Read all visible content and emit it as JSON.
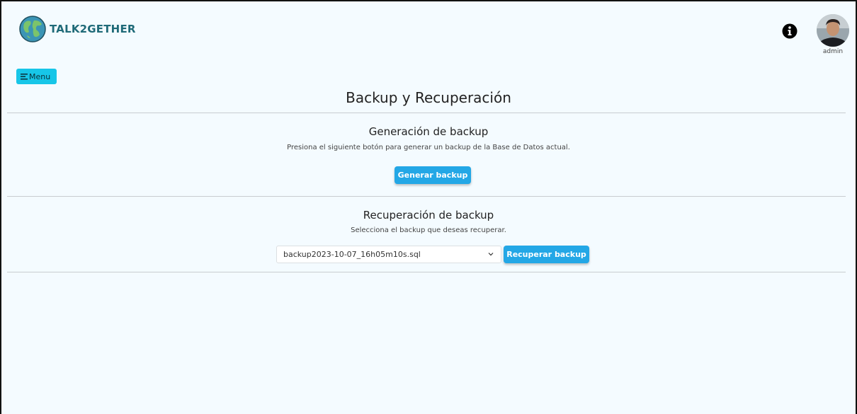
{
  "header": {
    "brand": "TALK2GETHER",
    "user_name": "admin"
  },
  "menu_label": "Menu",
  "page_title": "Backup y Recuperación",
  "generation": {
    "title": "Generación de backup",
    "description": "Presiona el siguiente botón para generar un backup de la Base de Datos actual.",
    "button_label": "Generar backup"
  },
  "recovery": {
    "title": "Recuperación de backup",
    "description": "Selecciona el backup que deseas recuperar.",
    "selected_backup": "backup2023-10-07_16h05m10s.sql",
    "button_label": "Recuperar backup"
  },
  "icons": {
    "logo": "globe-logo-icon",
    "info": "info-icon",
    "menu": "menu-lines-icon",
    "dropdown": "chevron-down-icon"
  },
  "colors": {
    "accent_cyan": "#17c6e8",
    "button_blue": "#23a7e6",
    "brand_teal": "#1f6a78",
    "background": "#f4fbff"
  }
}
